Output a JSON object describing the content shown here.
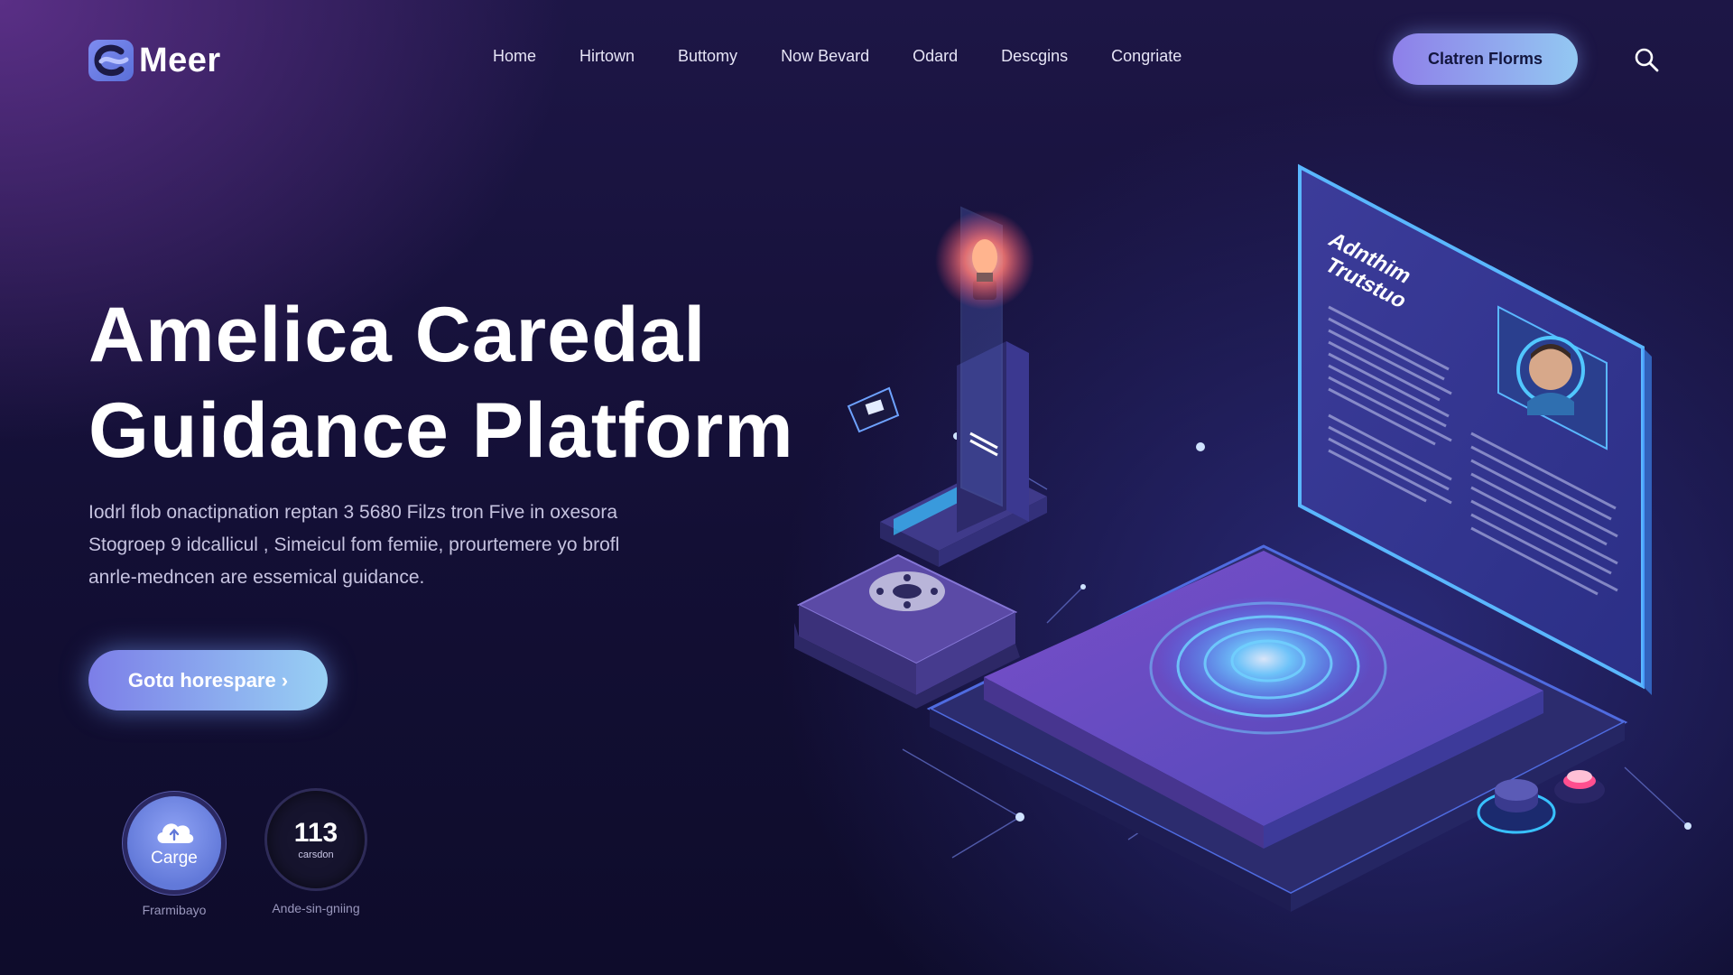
{
  "brand": {
    "name": "Meer"
  },
  "nav": {
    "items": [
      "Home",
      "Hirtown",
      "Buttomy",
      "Now Bevard",
      "Odard",
      "Descgins",
      "Congriate"
    ],
    "cta_label": "Clatren Florms"
  },
  "hero": {
    "title_line1": "Amelica Caredal",
    "title_line2": "Guidance Platform",
    "desc_line1": "Iodrl flob onactipnation reptan 3 5680 Filzs tron Five in oxesora",
    "desc_line2": "Stogroep 9 idcallicul , Simeicul fom femiie, prourtemere yo brofl",
    "desc_line3": "anrle-medncen are essemical guidance.",
    "cta_label": "Gotɑ horespare",
    "cta_arrow": "›"
  },
  "badges": [
    {
      "value": "Carge",
      "label": "Frarmibayo",
      "icon": "cloud-upload-icon"
    },
    {
      "value": "113",
      "sub": "carsdon",
      "label": "Ande-sin-gniing"
    }
  ],
  "illustration": {
    "panel_title_line1": "Adnthim",
    "panel_title_line2": "Trutstuo"
  },
  "colors": {
    "accent_start": "#8e7fe9",
    "accent_end": "#93c8f2",
    "background": "#130f35"
  }
}
